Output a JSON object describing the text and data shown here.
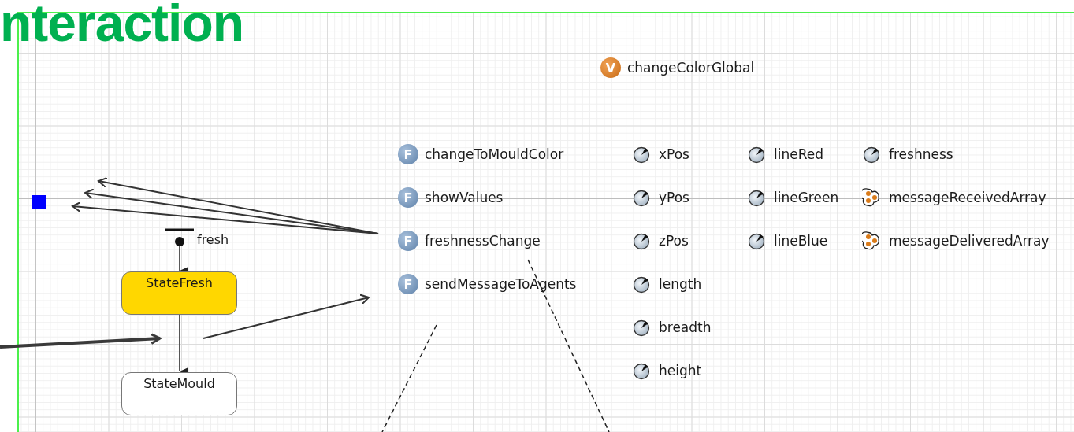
{
  "heading": "nteraction",
  "variable": {
    "badge": "V",
    "name": "changeColorGlobal"
  },
  "functions": [
    {
      "badge": "F",
      "name": "changeToMouldColor"
    },
    {
      "badge": "F",
      "name": "showValues"
    },
    {
      "badge": "F",
      "name": "freshnessChange"
    },
    {
      "badge": "F",
      "name": "sendMessageToAgents"
    }
  ],
  "columns": [
    {
      "items": [
        {
          "kind": "parameter",
          "name": "xPos"
        },
        {
          "kind": "parameter",
          "name": "yPos"
        },
        {
          "kind": "parameter",
          "name": "zPos"
        },
        {
          "kind": "parameter",
          "name": "length"
        },
        {
          "kind": "parameter",
          "name": "breadth"
        },
        {
          "kind": "parameter",
          "name": "height"
        }
      ]
    },
    {
      "items": [
        {
          "kind": "parameter",
          "name": "lineRed"
        },
        {
          "kind": "parameter",
          "name": "lineGreen"
        },
        {
          "kind": "parameter",
          "name": "lineBlue"
        }
      ]
    },
    {
      "items": [
        {
          "kind": "parameter",
          "name": "freshness"
        },
        {
          "kind": "collection",
          "name": "messageReceivedArray"
        },
        {
          "kind": "collection",
          "name": "messageDeliveredArray"
        }
      ]
    }
  ],
  "statechart": {
    "entry_label": "fresh",
    "states": [
      {
        "name": "StateFresh",
        "active": true
      },
      {
        "name": "StateMould",
        "active": false
      }
    ]
  }
}
